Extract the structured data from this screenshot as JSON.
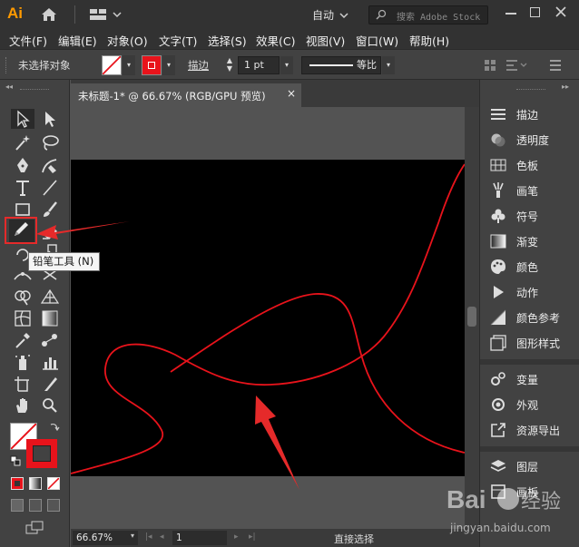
{
  "app": {
    "logo": "Ai",
    "mode": "自动",
    "search_placeholder": "搜索 Adobe Stock",
    "icons": [
      "home-icon",
      "layout-icon",
      "search-icon"
    ]
  },
  "menu": [
    "文件(F)",
    "编辑(E)",
    "对象(O)",
    "文字(T)",
    "选择(S)",
    "效果(C)",
    "视图(V)",
    "窗口(W)",
    "帮助(H)"
  ],
  "control": {
    "selection_status": "未选择对象",
    "stroke_label": "描边",
    "stroke_weight": "1 pt",
    "profile_label": "等比"
  },
  "document": {
    "tab_title": "未标题-1* @ 66.67% (RGB/GPU 预览)",
    "close": "×"
  },
  "status": {
    "zoom": "66.67%",
    "page": "1",
    "current_tool": "直接选择"
  },
  "tooltip": "铅笔工具 (N)",
  "panels": [
    {
      "label": "描边",
      "icon": "stroke-icon"
    },
    {
      "label": "透明度",
      "icon": "transparency-icon"
    },
    {
      "label": "色板",
      "icon": "swatches-icon"
    },
    {
      "label": "画笔",
      "icon": "brush-icon"
    },
    {
      "label": "符号",
      "icon": "symbol-icon"
    },
    {
      "label": "渐变",
      "icon": "gradient-icon"
    },
    {
      "label": "颜色",
      "icon": "color-icon"
    },
    {
      "label": "动作",
      "icon": "actions-icon"
    },
    {
      "label": "颜色参考",
      "icon": "color-guide-icon"
    },
    {
      "label": "图形样式",
      "icon": "graphic-styles-icon"
    },
    {
      "label": "变量",
      "icon": "variables-icon"
    },
    {
      "label": "外观",
      "icon": "appearance-icon"
    },
    {
      "label": "资源导出",
      "icon": "asset-export-icon"
    },
    {
      "label": "图层",
      "icon": "layers-icon"
    },
    {
      "label": "画板",
      "icon": "artboards-icon"
    }
  ],
  "colors": {
    "accent": "#ff9a00",
    "stroke": "#e8131b",
    "highlight": "#e52a2a",
    "artboard": "#000000"
  },
  "watermark": "Baidu经验 jingyan.baidu.com"
}
